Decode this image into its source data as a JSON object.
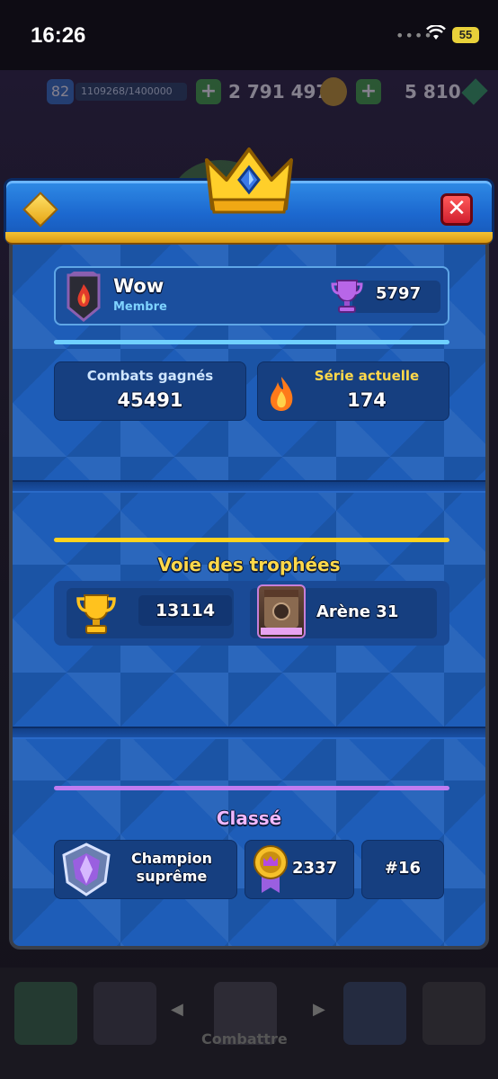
{
  "status_bar": {
    "time": "16:26",
    "battery": "55"
  },
  "background": {
    "level": "82",
    "xp": "1109268/1400000",
    "gold": "2 791 497",
    "gems": "5 810",
    "combat_tab": "Combattre"
  },
  "player": {
    "name": "Wow",
    "role": "Membre",
    "trophies": "5797"
  },
  "stats": {
    "wins_label": "Combats gagnés",
    "wins_value": "45491",
    "streak_label": "Série actuelle",
    "streak_value": "174"
  },
  "trophy_road": {
    "title": "Voie des trophées",
    "trophies": "13114",
    "arena": "Arène 31"
  },
  "ranked": {
    "title": "Classé",
    "league": "Champion suprême",
    "rating": "2337",
    "position": "#16"
  },
  "colors": {
    "accent_blue": "#1e5db8",
    "gold": "#ffd21e",
    "purple": "#c07cf0",
    "cyan": "#6fd0ff",
    "close_red": "#d11f2f"
  }
}
